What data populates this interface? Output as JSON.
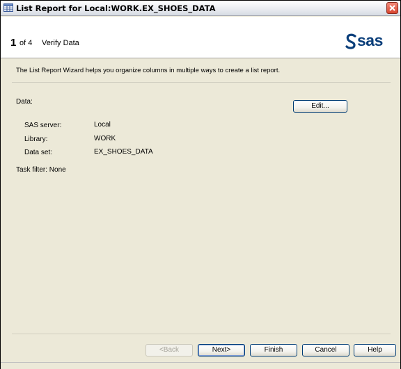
{
  "window": {
    "title": "List Report for Local:WORK.EX_SHOES_DATA"
  },
  "header": {
    "step_number": "1",
    "step_of": "of 4",
    "step_title": "Verify Data",
    "logo_text": "sas",
    "logo_color": "#0a3e7a"
  },
  "main": {
    "intro": "The List Report Wizard helps you organize columns in multiple ways to create a list report.",
    "data_label": "Data:",
    "edit_button": "Edit...",
    "fields": [
      {
        "label": "SAS server:",
        "value": "Local"
      },
      {
        "label": "Library:",
        "value": "WORK"
      },
      {
        "label": "Data set:",
        "value": "EX_SHOES_DATA"
      }
    ],
    "task_filter": "Task filter: None"
  },
  "footer": {
    "back": "<Back",
    "next": "Next>",
    "finish": "Finish",
    "cancel": "Cancel",
    "help": "Help"
  },
  "icons": {
    "window_icon": "table-icon",
    "close": "close-icon"
  }
}
